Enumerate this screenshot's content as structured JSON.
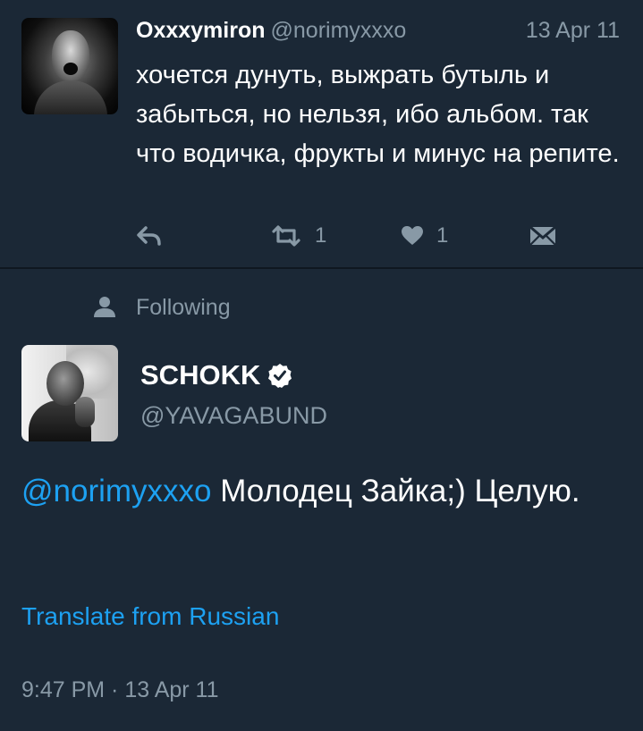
{
  "parent_tweet": {
    "author_name": "Oxxxymiron",
    "author_handle": "@norimyxxxo",
    "date": "13 Apr 11",
    "text": "хочется дунуть, выжрать бутыль и забыться, но нельзя, ибо альбом. так что водичка, фрукты и минус на репите.",
    "actions": {
      "reply_icon": "reply-icon",
      "retweet_icon": "retweet-icon",
      "retweet_count": "1",
      "like_icon": "heart-icon",
      "like_count": "1",
      "dm_icon": "direct-message-icon"
    }
  },
  "context": {
    "icon": "person-icon",
    "label": "Following"
  },
  "main_tweet": {
    "author_name": "SCHOKK",
    "verified_icon": "verified-badge-icon",
    "author_handle": "@YAVAGABUND",
    "mention": "@norimyxxxo",
    "text_after_mention": " Молодец Зайка;) Целую.",
    "translate_label": "Translate from Russian",
    "timestamp": "9:47 PM · 13 Apr 11"
  },
  "colors": {
    "background": "#1b2836",
    "primary_text": "#ffffff",
    "secondary_text": "#8899a6",
    "link": "#1da1f2"
  }
}
